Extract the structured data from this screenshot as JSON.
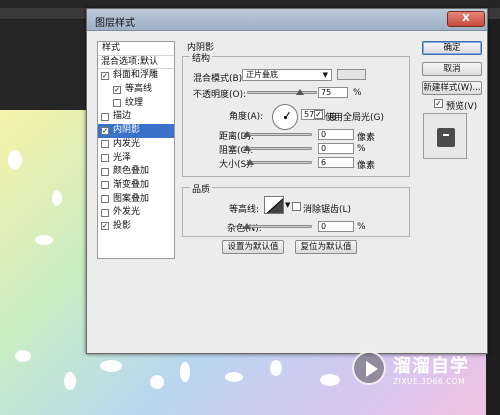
{
  "dialog": {
    "title": "图层样式",
    "close_label": "X"
  },
  "style_list": {
    "header": "样式",
    "items": [
      {
        "label": "混合选项:默认",
        "checkbox": false,
        "checked": false,
        "indent": 0,
        "selected": false
      },
      {
        "label": "斜面和浮雕",
        "checkbox": true,
        "checked": true,
        "indent": 0,
        "selected": false
      },
      {
        "label": "等高线",
        "checkbox": true,
        "checked": true,
        "indent": 1,
        "selected": false
      },
      {
        "label": "纹理",
        "checkbox": true,
        "checked": false,
        "indent": 1,
        "selected": false
      },
      {
        "label": "描边",
        "checkbox": true,
        "checked": false,
        "indent": 0,
        "selected": false
      },
      {
        "label": "内阴影",
        "checkbox": true,
        "checked": true,
        "indent": 0,
        "selected": true
      },
      {
        "label": "内发光",
        "checkbox": true,
        "checked": false,
        "indent": 0,
        "selected": false
      },
      {
        "label": "光泽",
        "checkbox": true,
        "checked": false,
        "indent": 0,
        "selected": false
      },
      {
        "label": "颜色叠加",
        "checkbox": true,
        "checked": false,
        "indent": 0,
        "selected": false
      },
      {
        "label": "渐变叠加",
        "checkbox": true,
        "checked": false,
        "indent": 0,
        "selected": false
      },
      {
        "label": "图案叠加",
        "checkbox": true,
        "checked": false,
        "indent": 0,
        "selected": false
      },
      {
        "label": "外发光",
        "checkbox": true,
        "checked": false,
        "indent": 0,
        "selected": false
      },
      {
        "label": "投影",
        "checkbox": true,
        "checked": true,
        "indent": 0,
        "selected": false
      }
    ]
  },
  "inner_shadow": {
    "section_title": "内阴影",
    "structure": {
      "title": "结构",
      "blend_mode_label": "混合模式(B):",
      "blend_mode_value": "正片叠底",
      "opacity_label": "不透明度(O):",
      "opacity_value": "75",
      "opacity_unit": "%",
      "opacity_level": 0.75,
      "angle_label": "角度(A):",
      "angle_value": "57",
      "angle_unit": "度",
      "global_light_label": "使用全局光(G)",
      "global_light_checked": true,
      "distance_label": "距离(D):",
      "distance_value": "0",
      "distance_unit": "像素",
      "choke_label": "阻塞(C):",
      "choke_value": "0",
      "choke_unit": "%",
      "size_label": "大小(S):",
      "size_value": "6",
      "size_unit": "像素"
    },
    "quality": {
      "title": "品质",
      "contour_label": "等高线:",
      "antialias_label": "消除锯齿(L)",
      "antialias_checked": false,
      "noise_label": "杂色(N):",
      "noise_value": "0",
      "noise_unit": "%"
    },
    "make_default_label": "设置为默认值",
    "reset_default_label": "复位为默认值"
  },
  "right_buttons": {
    "ok_label": "确定",
    "cancel_label": "取消",
    "new_style_label": "新建样式(W)...",
    "preview_label": "预览(V)",
    "preview_checked": true
  },
  "watermark": {
    "name": "溜溜自学",
    "url": "ZIXUE.3D66.COM"
  },
  "colors": {
    "selection": "#3a72c9",
    "close_button": "#c64a3a",
    "titlebar": "#a9bacd"
  }
}
